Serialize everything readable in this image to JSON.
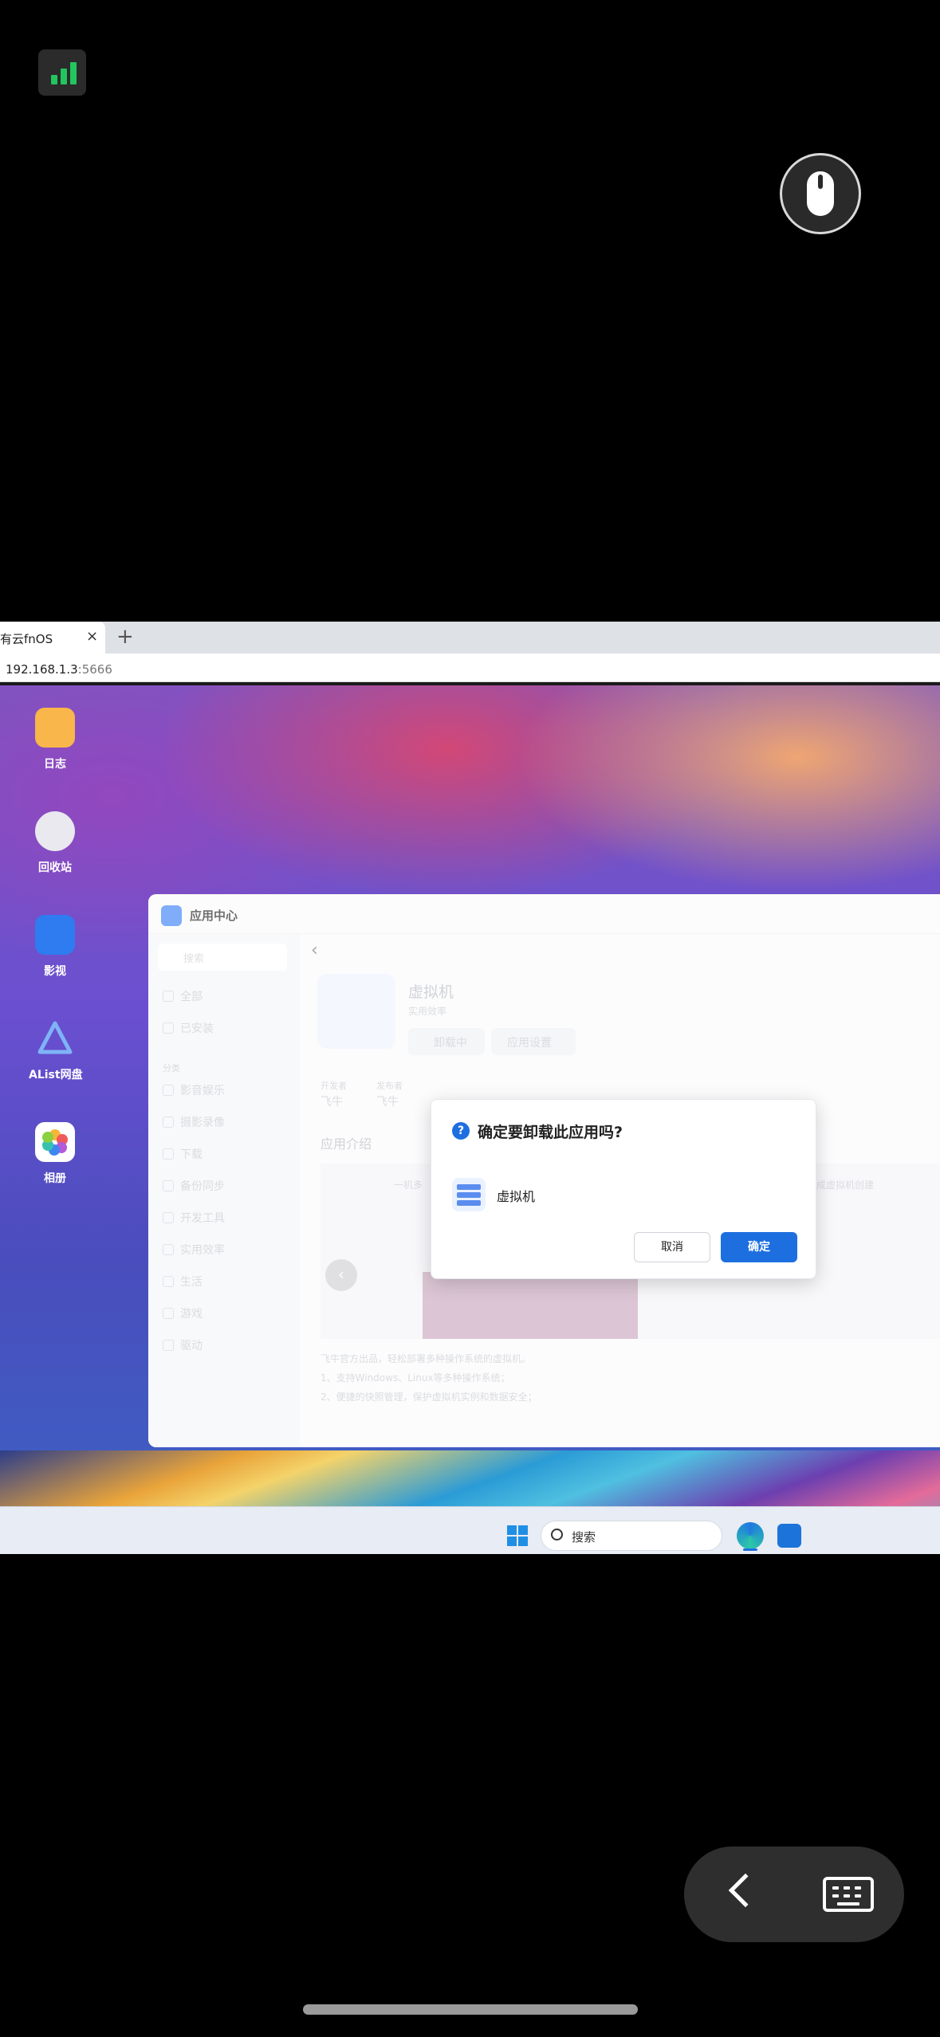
{
  "phone_status": {
    "signal_icon": "signal-bars-icon",
    "mouse_mode_icon": "mouse-icon"
  },
  "browser": {
    "tab_title": "有云fnOS",
    "tab_close": "×",
    "new_tab": "+",
    "address_host": "192.168.1.3",
    "address_port": ":5666"
  },
  "desktop_icons": [
    {
      "label": "日志",
      "icon": "log-icon",
      "color": "#f9b64a"
    },
    {
      "label": "回收站",
      "icon": "recycle-bin-icon",
      "color": "#e9e9ef"
    },
    {
      "label": "影视",
      "icon": "video-app-icon",
      "color": "#2f7bf0"
    },
    {
      "label": "AList网盘",
      "icon": "alist-icon",
      "color": "#6aa8f5"
    },
    {
      "label": "相册",
      "icon": "photos-icon",
      "color": "#ffffff"
    }
  ],
  "app_window": {
    "title": "应用中心",
    "search_placeholder": "搜索",
    "sidebar": {
      "items_top": [
        "全部",
        "已安装"
      ],
      "section": "分类",
      "categories": [
        "影音娱乐",
        "摄影录像",
        "下载",
        "备份同步",
        "开发工具",
        "实用效率",
        "生活",
        "游戏",
        "驱动"
      ]
    },
    "app": {
      "name": "虚拟机",
      "category": "实用效率",
      "status_button": "卸载中",
      "settings_button": "应用设置",
      "developer_label": "开发者",
      "developer_value": "飞牛",
      "publisher_label": "发布者",
      "publisher_value": "飞牛",
      "intro_heading": "应用介绍",
      "screenshot_caption_left": "一机多",
      "screenshot_caption_right": "完成虚拟机创建",
      "desc_lines": [
        "飞牛官方出品，轻松部署多种操作系统的虚拟机。",
        "1、支持Windows、Linux等多种操作系统；",
        "2、便捷的快照管理，保护虚拟机实例和数据安全；"
      ]
    }
  },
  "dialog": {
    "title": "确定要卸载此应用吗?",
    "app_name": "虚拟机",
    "cancel": "取消",
    "confirm": "确定"
  },
  "taskbar": {
    "search_placeholder": "搜索",
    "start_icon": "windows-start-icon",
    "browser_icon": "edge-icon",
    "app_icon": "cloud-app-icon"
  },
  "nav": {
    "back_icon": "chevron-left-icon",
    "keyboard_icon": "keyboard-icon"
  }
}
